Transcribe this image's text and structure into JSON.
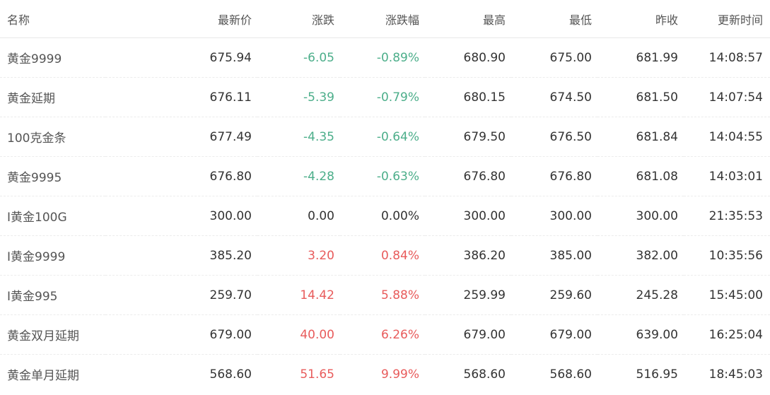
{
  "columns": {
    "name": "名称",
    "latest": "最新价",
    "change": "涨跌",
    "change_pct": "涨跌幅",
    "high": "最高",
    "low": "最低",
    "prev_close": "昨收",
    "update_time": "更新时间"
  },
  "colors": {
    "up": "#e85b5b",
    "down": "#4cae8a",
    "flat": "#333333"
  },
  "rows": [
    {
      "name": "黄金9999",
      "latest": "675.94",
      "change": "-6.05",
      "change_pct": "-0.89%",
      "high": "680.90",
      "low": "675.00",
      "prev_close": "681.99",
      "update_time": "14:08:57",
      "trend": "down"
    },
    {
      "name": "黄金延期",
      "latest": "676.11",
      "change": "-5.39",
      "change_pct": "-0.79%",
      "high": "680.15",
      "low": "674.50",
      "prev_close": "681.50",
      "update_time": "14:07:54",
      "trend": "down"
    },
    {
      "name": "100克金条",
      "latest": "677.49",
      "change": "-4.35",
      "change_pct": "-0.64%",
      "high": "679.50",
      "low": "676.50",
      "prev_close": "681.84",
      "update_time": "14:04:55",
      "trend": "down"
    },
    {
      "name": "黄金9995",
      "latest": "676.80",
      "change": "-4.28",
      "change_pct": "-0.63%",
      "high": "676.80",
      "low": "676.80",
      "prev_close": "681.08",
      "update_time": "14:03:01",
      "trend": "down"
    },
    {
      "name": "I黄金100G",
      "latest": "300.00",
      "change": "0.00",
      "change_pct": "0.00%",
      "high": "300.00",
      "low": "300.00",
      "prev_close": "300.00",
      "update_time": "21:35:53",
      "trend": "flat"
    },
    {
      "name": "I黄金9999",
      "latest": "385.20",
      "change": "3.20",
      "change_pct": "0.84%",
      "high": "386.20",
      "low": "385.00",
      "prev_close": "382.00",
      "update_time": "10:35:56",
      "trend": "up"
    },
    {
      "name": "I黄金995",
      "latest": "259.70",
      "change": "14.42",
      "change_pct": "5.88%",
      "high": "259.99",
      "low": "259.60",
      "prev_close": "245.28",
      "update_time": "15:45:00",
      "trend": "up"
    },
    {
      "name": "黄金双月延期",
      "latest": "679.00",
      "change": "40.00",
      "change_pct": "6.26%",
      "high": "679.00",
      "low": "679.00",
      "prev_close": "639.00",
      "update_time": "16:25:04",
      "trend": "up"
    },
    {
      "name": "黄金单月延期",
      "latest": "568.60",
      "change": "51.65",
      "change_pct": "9.99%",
      "high": "568.60",
      "low": "568.60",
      "prev_close": "516.95",
      "update_time": "18:45:03",
      "trend": "up"
    }
  ]
}
